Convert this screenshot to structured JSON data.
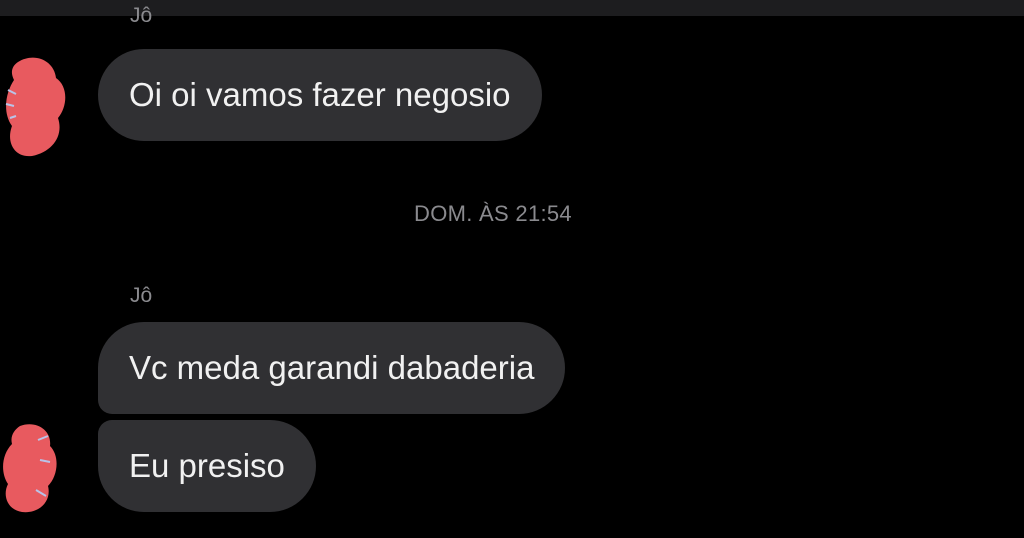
{
  "conversation": {
    "messages": [
      {
        "sender": "Jô",
        "text": "Oi oi vamos fazer negosio"
      },
      {
        "text": "Vc meda garandi dabaderia"
      },
      {
        "text": "Eu presiso"
      }
    ],
    "timestamp": "DOM. ÀS 21:54",
    "second_sender": "Jô"
  },
  "colors": {
    "background": "#000000",
    "bubble": "#303033",
    "meta_text": "#8a8a8e",
    "avatar_redaction": "#e85a5f"
  },
  "icons": {
    "avatar": "redacted-avatar-icon"
  }
}
